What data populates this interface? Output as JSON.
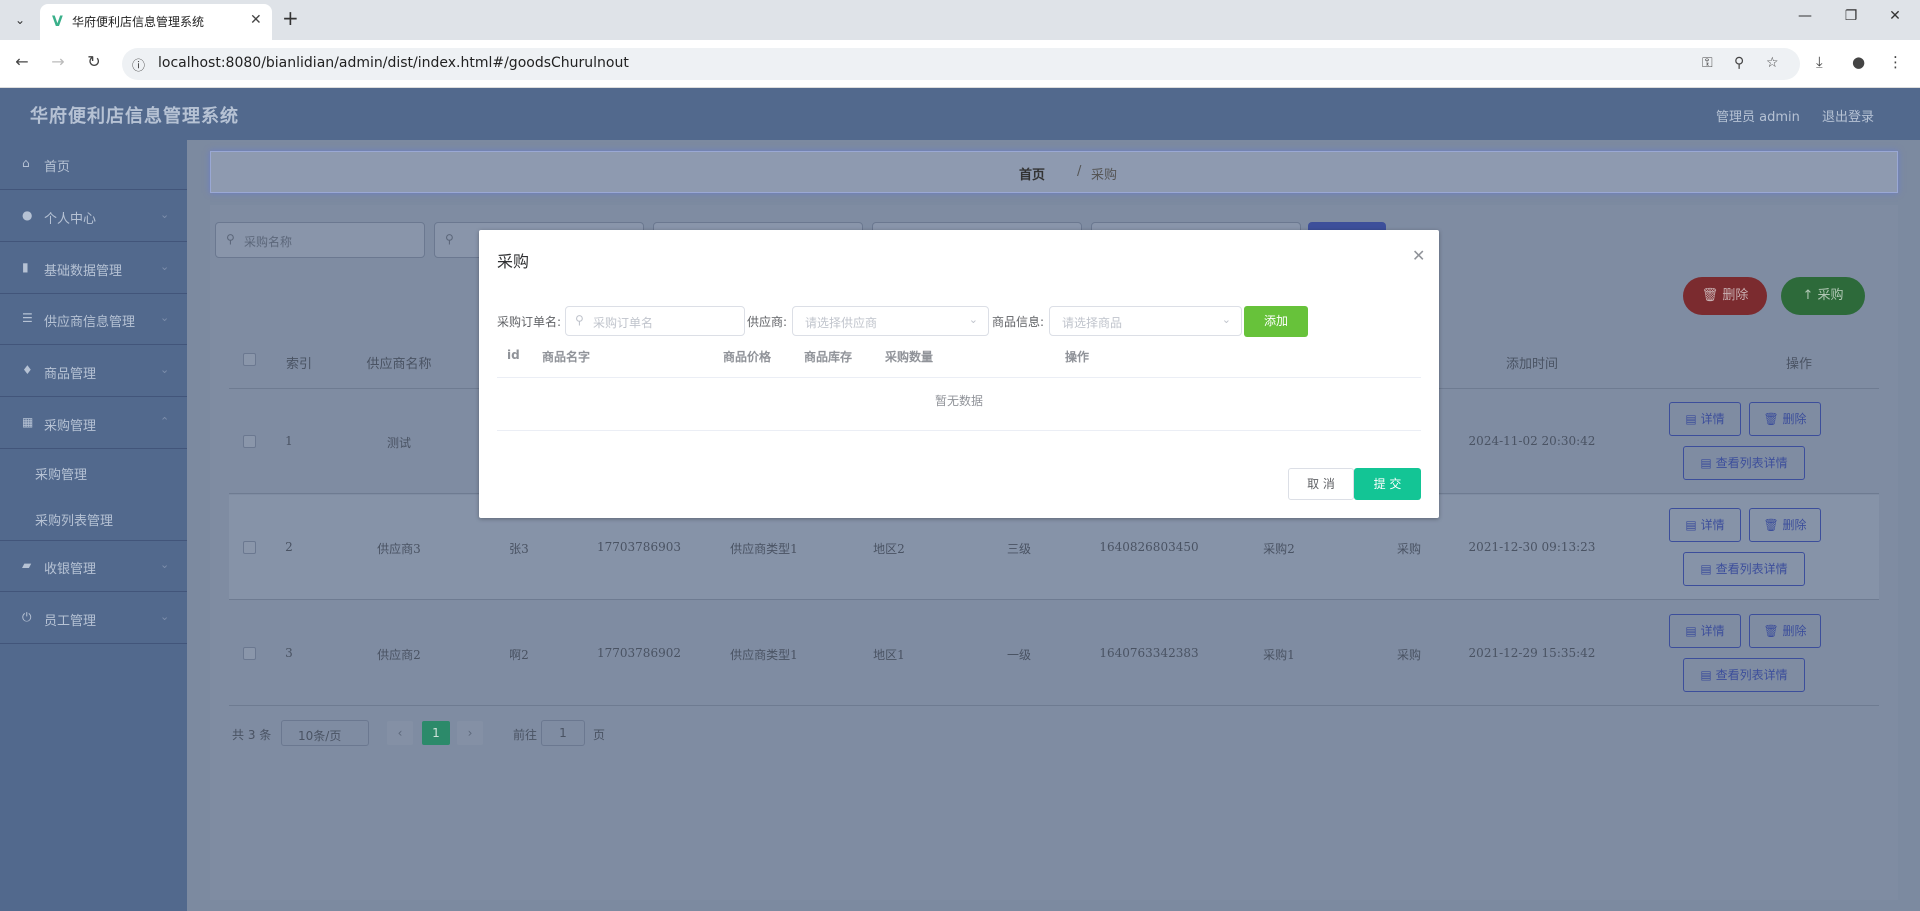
{
  "browser": {
    "tab_title": "华府便利店信息管理系统",
    "url": "localhost:8080/bianlidian/admin/dist/index.html#/goodsChurulnout"
  },
  "app": {
    "title": "华府便利店信息管理系统",
    "user": "管理员 admin",
    "logout": "退出登录"
  },
  "sidebar": {
    "items": [
      {
        "label": "首页"
      },
      {
        "label": "个人中心"
      },
      {
        "label": "基础数据管理"
      },
      {
        "label": "供应商信息管理"
      },
      {
        "label": "商品管理"
      },
      {
        "label": "采购管理"
      },
      {
        "label": "采购管理"
      },
      {
        "label": "采购列表管理"
      },
      {
        "label": "收银管理"
      },
      {
        "label": "员工管理"
      }
    ]
  },
  "breadcrumb": {
    "home": "首页",
    "sep": "/",
    "current": "采购"
  },
  "search": {
    "name_placeholder": "采购名称"
  },
  "actions": {
    "delete": "删除",
    "purchase": "采购"
  },
  "table": {
    "headers": [
      "索引",
      "供应商名称",
      "添加时间",
      "操作"
    ],
    "rows": [
      {
        "index": "1",
        "supplier": "测试",
        "contact": "",
        "phone": "",
        "type": "",
        "region": "",
        "level": "",
        "code": "",
        "purchase": "",
        "status": "",
        "time": "2024-11-02 20:30:42"
      },
      {
        "index": "2",
        "supplier": "供应商3",
        "contact": "张3",
        "phone": "17703786903",
        "type": "供应商类型1",
        "region": "地区2",
        "level": "三级",
        "code": "1640826803450",
        "purchase": "采购2",
        "status": "采购",
        "time": "2021-12-30 09:13:23"
      },
      {
        "index": "3",
        "supplier": "供应商2",
        "contact": "啊2",
        "phone": "17703786902",
        "type": "供应商类型1",
        "region": "地区1",
        "level": "一级",
        "code": "1640763342383",
        "purchase": "采购1",
        "status": "采购",
        "time": "2021-12-29 15:35:42"
      }
    ],
    "op_detail": "详情",
    "op_delete": "删除",
    "op_list_detail": "查看列表详情"
  },
  "pagination": {
    "total": "共 3 条",
    "page_size": "10条/页",
    "current": "1",
    "goto": "前往",
    "goto_value": "1",
    "page_suffix": "页"
  },
  "modal": {
    "title": "采购",
    "order_label": "采购订单名:",
    "order_placeholder": "采购订单名",
    "supplier_label": "供应商:",
    "supplier_placeholder": "请选择供应商",
    "goods_label": "商品信息:",
    "goods_placeholder": "请选择商品",
    "add": "添加",
    "columns": [
      "id",
      "商品名字",
      "商品价格",
      "商品库存",
      "采购数量",
      "操作"
    ],
    "empty": "暂无数据",
    "cancel": "取 消",
    "submit": "提 交"
  }
}
